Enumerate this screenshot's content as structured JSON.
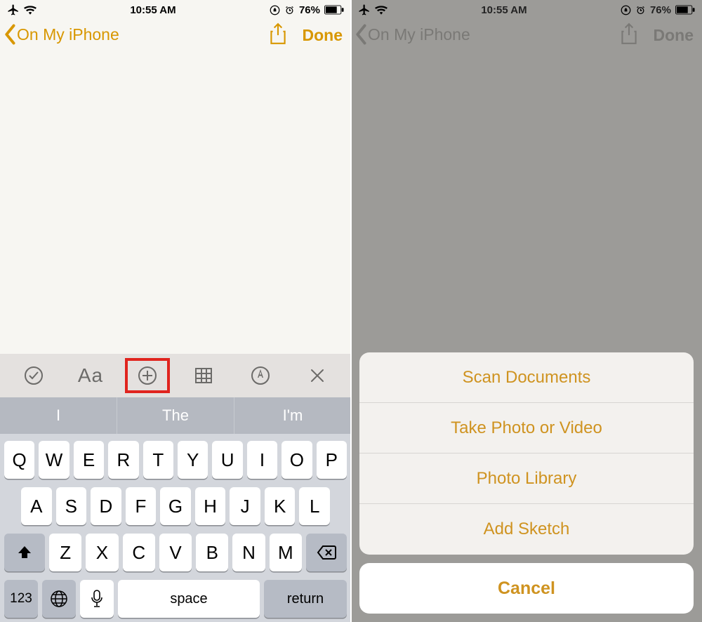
{
  "status": {
    "time": "10:55 AM",
    "battery_text": "76%"
  },
  "nav": {
    "back_label": "On My iPhone",
    "done_label": "Done"
  },
  "toolbar": {
    "text_style_label": "Aa"
  },
  "predictive": [
    "I",
    "The",
    "I'm"
  ],
  "keyboard": {
    "row1": [
      "Q",
      "W",
      "E",
      "R",
      "T",
      "Y",
      "U",
      "I",
      "O",
      "P"
    ],
    "row2": [
      "A",
      "S",
      "D",
      "F",
      "G",
      "H",
      "J",
      "K",
      "L"
    ],
    "row3": [
      "Z",
      "X",
      "C",
      "V",
      "B",
      "N",
      "M"
    ],
    "k123": "123",
    "space": "space",
    "return": "return"
  },
  "action_sheet": {
    "items": [
      "Scan Documents",
      "Take Photo or Video",
      "Photo Library",
      "Add Sketch"
    ],
    "cancel": "Cancel"
  }
}
